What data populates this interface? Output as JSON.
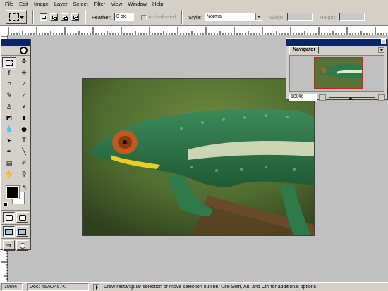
{
  "menubar": {
    "items": [
      {
        "label": "File"
      },
      {
        "label": "Edit"
      },
      {
        "label": "Image"
      },
      {
        "label": "Layer"
      },
      {
        "label": "Select"
      },
      {
        "label": "Filter"
      },
      {
        "label": "View"
      },
      {
        "label": "Window"
      },
      {
        "label": "Help"
      }
    ]
  },
  "options": {
    "feather_label": "Feather:",
    "feather_value": "0 px",
    "antialiased_label": "Anti-aliased",
    "style_label": "Style:",
    "style_value": "Normal",
    "width_label": "Width:",
    "height_label": "Height:"
  },
  "navigator": {
    "tab_label": "Navigator",
    "zoom_value": "100%"
  },
  "statusbar": {
    "zoom": "100%",
    "doc": "Doc: 457K/457K",
    "hint": "Draw rectangular selection or move selection outline. Use Shift, Alt, and Ctrl for additional options."
  },
  "colors": {
    "foreground": "#000000",
    "background": "#ffffff",
    "navigator_view_box": "#d02020"
  }
}
